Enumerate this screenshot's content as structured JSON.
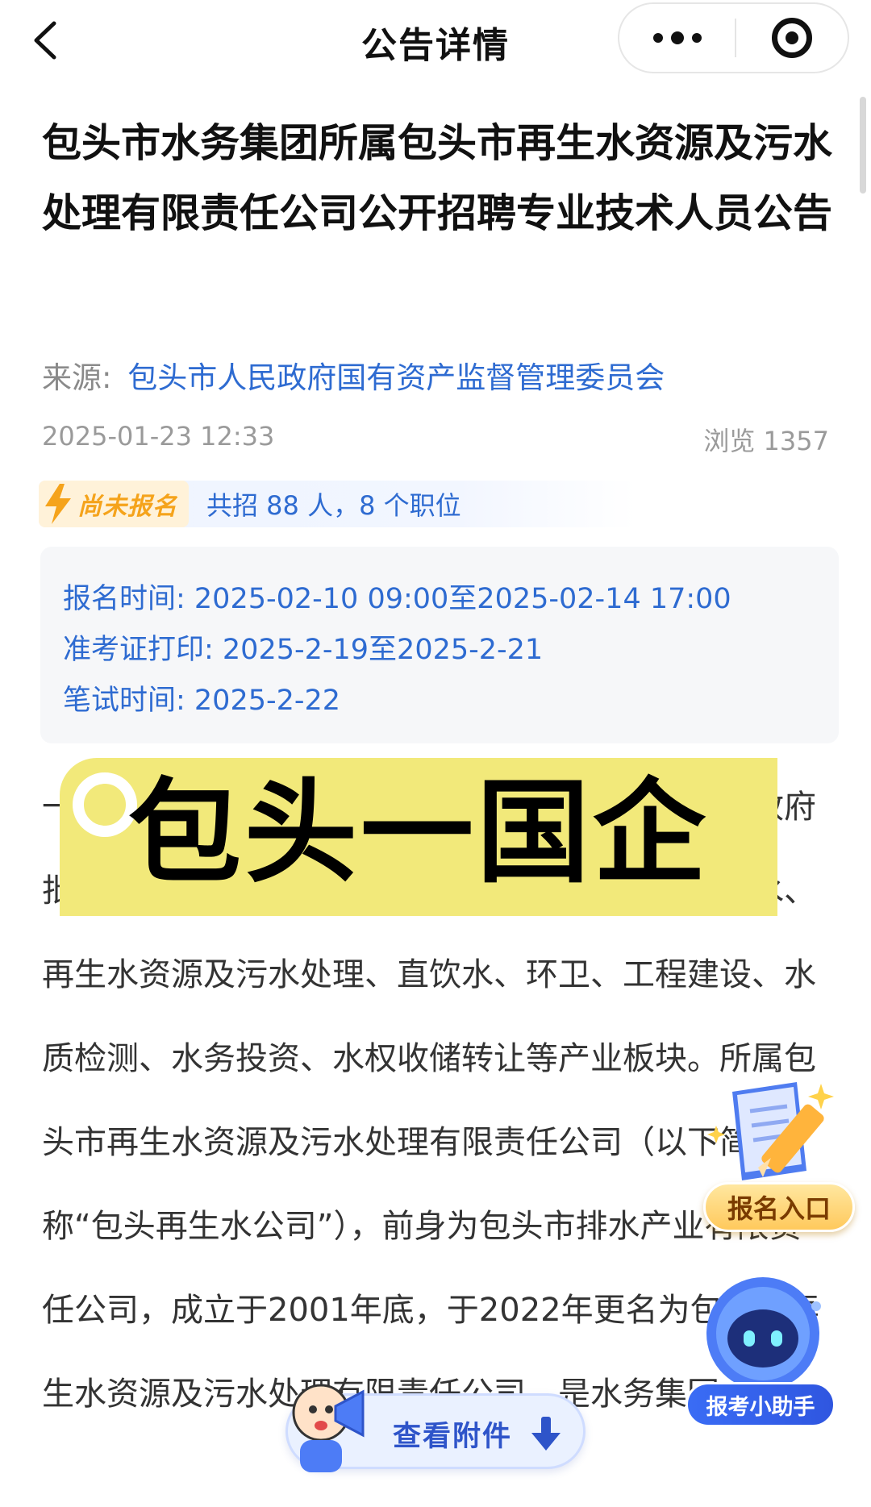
{
  "nav": {
    "title": "公告详情",
    "back_icon": "chevron-left-icon",
    "more_icon": "more-dots-icon",
    "close_icon": "target-close-icon"
  },
  "article": {
    "title": "包头市水务集团所属包头市再生水资源及污水处理有限责任公司公开招聘专业技术人员公告",
    "source_label": "来源:",
    "source_org": "包头市人民政府国有资产监督管理委员会",
    "date": "2025-01-23 12:33",
    "views": "浏览 1357",
    "status_badge": "尚未报名",
    "recruit_summary": "共招 88 人，8 个职位"
  },
  "schedule": {
    "signup": "报名时间: 2025-02-10 09:00至2025-02-14 17:00",
    "admit_print": "准考证打印: 2025-2-19至2025-2-21",
    "exam": "笔试时间: 2025-2-22"
  },
  "body": {
    "paragraph": "一、招聘单位简介包头市水务集团是经包头市人民政府批准组建成立的市直属国有独资公司，目前下设供水、再生水资源及污水处理、直饮水、环卫、工程建设、水质检测、水务投资、水权收储转让等产业板块。所属包头市再生水资源及污水处理有限责任公司（以下简称“包头再生水公司”），前身为包头市排水产业有限责任公司，成立于2001年底，于2022年更名为包头市再生水资源及污水处理有限责任公司，是水务集团、"
  },
  "overlays": {
    "banner_text": "包头一国企",
    "signup_entry": "报名入口",
    "assistant": "报考小助手",
    "attachment": "查看附件"
  },
  "colors": {
    "link_blue": "#2e6bd1",
    "badge_orange": "#f5a31b",
    "banner_yellow": "#f2e97a"
  }
}
